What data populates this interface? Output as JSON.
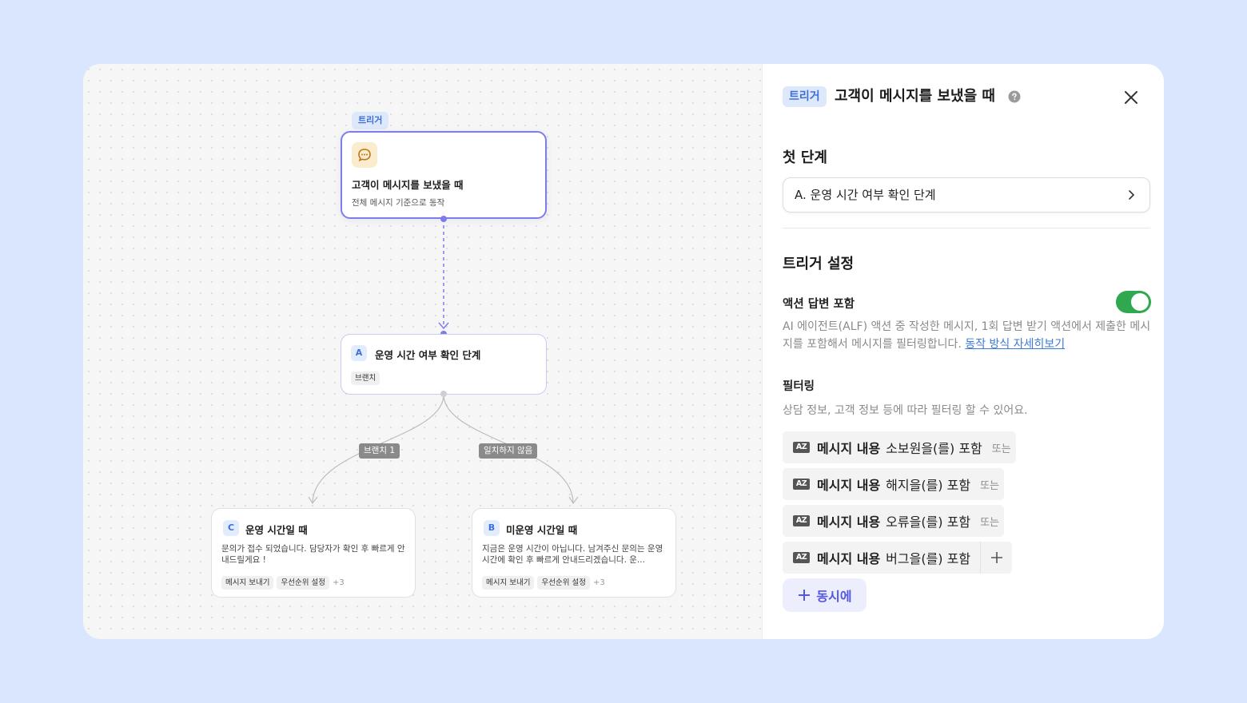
{
  "canvas": {
    "trigger_tag": "트리거",
    "trigger_node": {
      "title": "고객이 메시지를 보냈을 때",
      "subtitle": "전체 메시지 기준으로 동작"
    },
    "node_a": {
      "letter": "A",
      "title": "운영 시간 여부 확인 단계",
      "chip": "브랜치"
    },
    "edge_labels": [
      "브랜치 1",
      "일치하지 않음"
    ],
    "node_c": {
      "letter": "C",
      "title": "운영 시간일 때",
      "description": "문의가 접수 되었습니다. 담당자가 확인 후 빠르게 안내드릴게요 !",
      "chips": [
        "메시지 보내기",
        "우선순위 설정"
      ],
      "more": "+3"
    },
    "node_b": {
      "letter": "B",
      "title": "미운영 시간일 때",
      "description": "지금은 운영 시간이 아닙니다. 남겨주신 문의는 운영 시간에 확인 후 빠르게 안내드리겠습니다. 운...",
      "chips": [
        "메시지 보내기",
        "우선순위 설정"
      ],
      "more": "+3"
    }
  },
  "panel": {
    "header_tag": "트리거",
    "header_title": "고객이 메시지를 보냈을 때",
    "first_step_title": "첫 단계",
    "first_step_value": "A. 운영 시간 여부 확인 단계",
    "trigger_settings_title": "트리거 설정",
    "action_reply_label": "액션 답변 포함",
    "action_reply_enabled": true,
    "action_reply_desc": "AI 에이전트(ALF) 액션 중 작성한 메시지, 1회 답변 받기 액션에서 제출한 메시지를 포함해서 메시지를 필터링합니다.",
    "action_reply_link": "동작 방식 자세히보기",
    "filtering_title": "필터링",
    "filtering_desc": "상담 정보, 고객 정보 등에 따라 필터링 할 수 있어요.",
    "filters": [
      {
        "field": "메시지 내용",
        "condition": "소보원을(를) 포함",
        "joiner": "또는"
      },
      {
        "field": "메시지 내용",
        "condition": "해지을(를) 포함",
        "joiner": "또는"
      },
      {
        "field": "메시지 내용",
        "condition": "오류을(를) 포함",
        "joiner": "또는"
      },
      {
        "field": "메시지 내용",
        "condition": "버그을(를) 포함",
        "joiner": ""
      }
    ],
    "az_icon_text": "AZ",
    "and_button": "동시에"
  },
  "colors": {
    "accent": "#7b7dea",
    "tag_bg": "#dde8fb",
    "tag_text": "#3d6fd8",
    "toggle_on": "#2fa84f",
    "background": "#d9e6fd"
  }
}
